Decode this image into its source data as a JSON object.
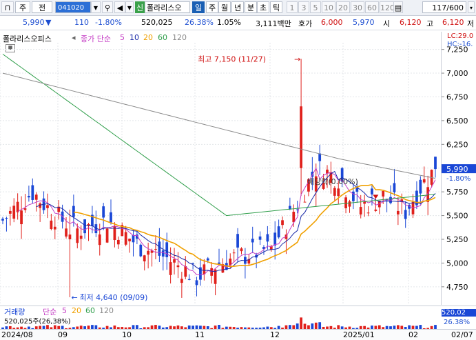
{
  "toolbar": {
    "market": "주",
    "prev": "전",
    "code": "041020",
    "name_badge": "신",
    "stock_name": "폴라리스오",
    "periods": [
      "일",
      "주",
      "월",
      "년",
      "분",
      "초",
      "틱"
    ],
    "intervals": [
      "1",
      "3",
      "5",
      "10",
      "20",
      "30",
      "60",
      "120"
    ],
    "count": "117/600"
  },
  "quote": {
    "price": "5,990",
    "change": "110",
    "change_pct": "-1.80%",
    "volume": "520,025",
    "turnover_ratio": "26.38%",
    "ratio2": "1.05%",
    "amount": "3,111백만",
    "hoga_label": "호가",
    "ask": "6,000",
    "bid": "5,970",
    "open_label": "시",
    "open": "6,120",
    "high_label": "고",
    "high": "6,120",
    "low_label": "저"
  },
  "legend": {
    "stock": "폴라리스오피스",
    "ma_label": "종가 단순",
    "ma_periods": [
      "5",
      "10",
      "20",
      "60",
      "120"
    ],
    "lc": "LC:29.0",
    "hc": "HC:-16."
  },
  "annotations": {
    "high": "최고 7,150 (11/27)",
    "low": "최저 4,640 (09/09)",
    "dividend": "배당락(0.00%)"
  },
  "price_axis": {
    "ticks": [
      "7,250",
      "7,000",
      "6,750",
      "6,500",
      "6,250",
      "6,000",
      "5,750",
      "5,500",
      "5,250",
      "5,000",
      "4,750"
    ],
    "current": "5,990",
    "current_pct": "-1.80%"
  },
  "volume_panel": {
    "label": "거래량",
    "ma_label": "단순",
    "ma_periods": [
      "5",
      "20",
      "60",
      "120"
    ],
    "value_text": "520,025주(26,38%)",
    "axis_value": "520,02",
    "axis_pct": "26.38%"
  },
  "x_axis": [
    "2024/08",
    "09",
    "10",
    "11",
    "12",
    "2025/01",
    "02",
    "02/07"
  ],
  "chart_data": {
    "type": "candlestick",
    "ylim": [
      4560,
      7320
    ],
    "n": 117,
    "high_point": {
      "value": 7150,
      "date": "11/27"
    },
    "low_point": {
      "value": 4640,
      "date": "09/09"
    },
    "last_close": 5990
  },
  "colors": {
    "up": "#e0201b",
    "down": "#1a47d6",
    "ma5": "#c43cc4",
    "ma10": "#1a2aa8",
    "ma20": "#f0a000",
    "ma60": "#2f9e4a",
    "ma120": "#8a8a8a"
  }
}
